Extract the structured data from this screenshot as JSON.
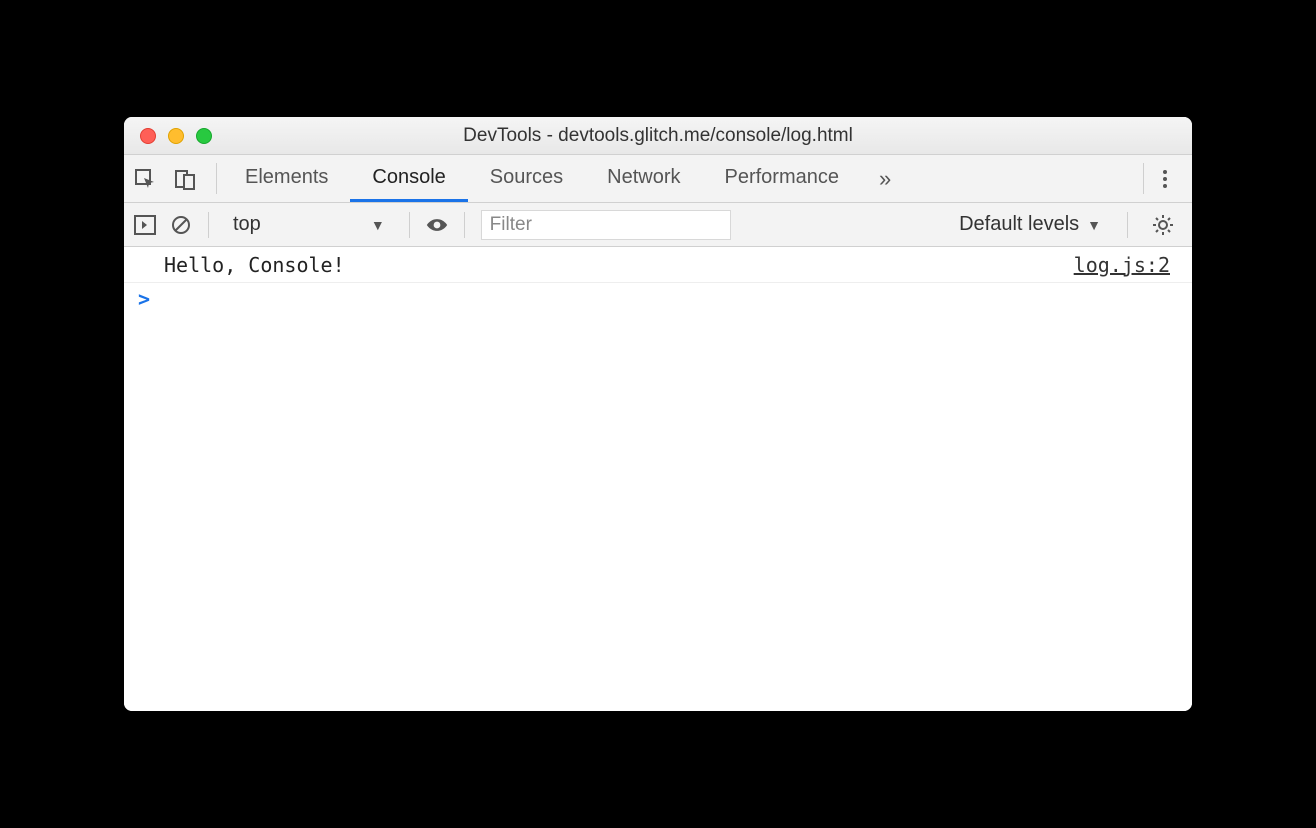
{
  "window": {
    "title": "DevTools - devtools.glitch.me/console/log.html"
  },
  "tabs": {
    "items": [
      "Elements",
      "Console",
      "Sources",
      "Network",
      "Performance"
    ],
    "active": "Console",
    "more_glyph": "»"
  },
  "toolbar": {
    "context": "top",
    "filter_placeholder": "Filter",
    "levels_label": "Default levels"
  },
  "console": {
    "logs": [
      {
        "message": "Hello, Console!",
        "source": "log.js:2"
      }
    ],
    "prompt": ">"
  }
}
